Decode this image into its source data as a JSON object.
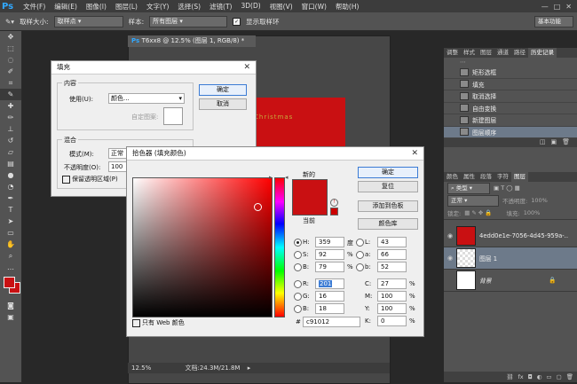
{
  "app": {
    "logo": "Ps",
    "menu": [
      "文件(F)",
      "编辑(E)",
      "图像(I)",
      "图层(L)",
      "文字(Y)",
      "选择(S)",
      "滤镜(T)",
      "3D(D)",
      "视图(V)",
      "窗口(W)",
      "帮助(H)"
    ],
    "window_buttons": [
      "—",
      "□",
      "✕"
    ]
  },
  "options_bar": {
    "sample_size_label": "取样大小:",
    "sample_size_value": "取样点",
    "sample_label": "样本:",
    "sample_value": "所有图层",
    "show_ring_label": "显示取样环",
    "workspace_value": "基本功能"
  },
  "document": {
    "tab_title": "T6xx8 @ 12.5% (图层 1, RGB/8) *",
    "canvas_text": "Christmas",
    "zoom": "12.5%",
    "doc_info": "文档:24.3M/21.8M"
  },
  "history_panel": {
    "tabs": [
      "调整",
      "样式",
      "图层",
      "通道",
      "路径",
      "历史记录"
    ],
    "active_tab": "历史记录",
    "items": [
      "矩形选框",
      "填充",
      "取消选择",
      "自由变换",
      "新建图层",
      "图层顺序"
    ]
  },
  "layers_panel": {
    "tabs": [
      "颜色",
      "属性",
      "段落",
      "字符",
      "图层"
    ],
    "active_tab": "图层",
    "filter_label": "类型",
    "blend_mode": "正常",
    "opacity_label": "不透明度:",
    "opacity_value": "100%",
    "lock_label": "锁定:",
    "fill_label": "填充:",
    "fill_value": "100%",
    "layers": [
      {
        "name": "4edd0e1e-7056-4d45-959a-...",
        "type": "image"
      },
      {
        "name": "图层 1",
        "type": "transparent"
      },
      {
        "name": "背景",
        "type": "background"
      }
    ]
  },
  "fill_dialog": {
    "title": "填充",
    "contents_label": "内容",
    "use_label": "使用(U):",
    "use_value": "颜色...",
    "custom_pattern_label": "自定图案:",
    "blending_label": "混合",
    "mode_label": "模式(M):",
    "mode_value": "正常",
    "opacity_label": "不透明度(O):",
    "opacity_value": "100",
    "preserve_label": "保留透明区域(P)",
    "ok_label": "确定",
    "cancel_label": "取消"
  },
  "color_picker": {
    "title": "拾色器 (填充颜色)",
    "new_label": "新的",
    "current_label": "当前",
    "ok_label": "确定",
    "reset_label": "复位",
    "add_swatch_label": "添加到色板",
    "libraries_label": "颜色库",
    "web_only_label": "只有 Web 颜色",
    "new_color": "#c91012",
    "current_color": "#c91012",
    "h": {
      "label": "H:",
      "value": "359",
      "unit": "度"
    },
    "s": {
      "label": "S:",
      "value": "92",
      "unit": "%"
    },
    "b": {
      "label": "B:",
      "value": "79",
      "unit": "%"
    },
    "r": {
      "label": "R:",
      "value": "201"
    },
    "g": {
      "label": "G:",
      "value": "16"
    },
    "bl": {
      "label": "B:",
      "value": "18"
    },
    "l": {
      "label": "L:",
      "value": "43"
    },
    "a": {
      "label": "a:",
      "value": "66"
    },
    "lb": {
      "label": "b:",
      "value": "52"
    },
    "c": {
      "label": "C:",
      "value": "27",
      "unit": "%"
    },
    "m": {
      "label": "M:",
      "value": "100",
      "unit": "%"
    },
    "y": {
      "label": "Y:",
      "value": "100",
      "unit": "%"
    },
    "k": {
      "label": "K:",
      "value": "0",
      "unit": "%"
    },
    "hex_label": "#",
    "hex_value": "c91012"
  }
}
